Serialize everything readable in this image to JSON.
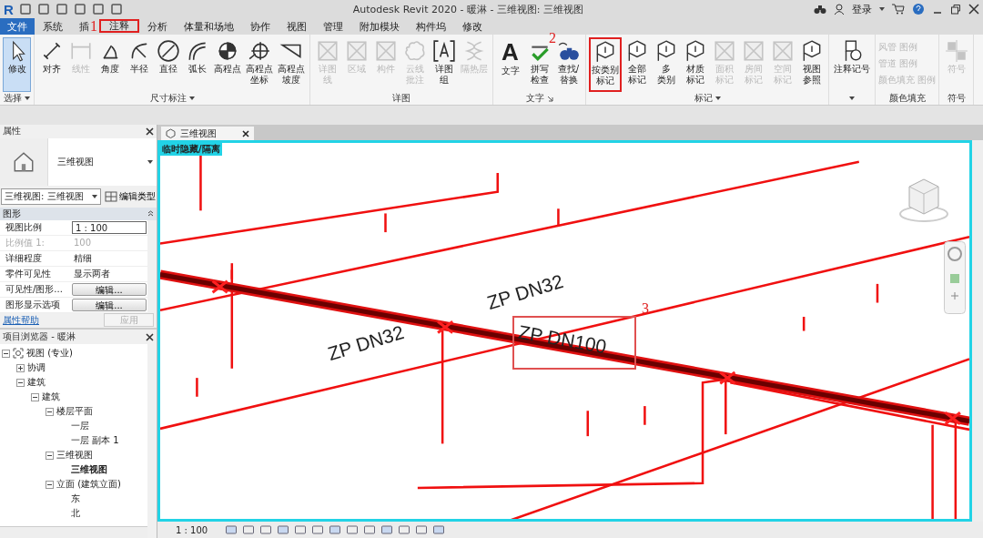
{
  "title_bar": {
    "logo": "R",
    "title": "Autodesk Revit 2020 - 暖淋 - 三维视图: 三维视图",
    "sign_in": "登录"
  },
  "tabs": [
    {
      "label": "文件",
      "kind": "file",
      "selected": false
    },
    {
      "label": "系统",
      "kind": "tab",
      "selected": false
    },
    {
      "label": "插",
      "kind": "tab",
      "selected": false
    },
    {
      "label": "注释",
      "kind": "tab",
      "selected": true
    },
    {
      "label": "分析",
      "kind": "tab",
      "selected": false
    },
    {
      "label": "体量和场地",
      "kind": "tab",
      "selected": false
    },
    {
      "label": "协作",
      "kind": "tab",
      "selected": false
    },
    {
      "label": "视图",
      "kind": "tab",
      "selected": false
    },
    {
      "label": "管理",
      "kind": "tab",
      "selected": false
    },
    {
      "label": "附加模块",
      "kind": "tab",
      "selected": false
    },
    {
      "label": "构件坞",
      "kind": "tab",
      "selected": false
    },
    {
      "label": "修改",
      "kind": "tab",
      "selected": false
    }
  ],
  "ribbon": [
    {
      "title": "选择",
      "menu": true,
      "launcher": false,
      "buttons": [
        {
          "lines": [
            "修改"
          ],
          "kind": "cursor",
          "disabled": false,
          "selected": true,
          "highlighted": false
        }
      ]
    },
    {
      "title": "尺寸标注",
      "menu": true,
      "launcher": false,
      "buttons": [
        {
          "lines": [
            "对齐"
          ],
          "kind": "dimension",
          "disabled": false,
          "selected": false,
          "highlighted": false
        },
        {
          "lines": [
            "线性"
          ],
          "kind": "linear",
          "disabled": true,
          "selected": false,
          "highlighted": false
        },
        {
          "lines": [
            "角度"
          ],
          "kind": "angle",
          "disabled": false,
          "selected": false,
          "highlighted": false
        },
        {
          "lines": [
            "半径"
          ],
          "kind": "radius",
          "disabled": false,
          "selected": false,
          "highlighted": false
        },
        {
          "lines": [
            "直径"
          ],
          "kind": "diameter",
          "disabled": false,
          "selected": false,
          "highlighted": false
        },
        {
          "lines": [
            "弧长"
          ],
          "kind": "arc",
          "disabled": false,
          "selected": false,
          "highlighted": false
        },
        {
          "lines": [
            "高程点"
          ],
          "kind": "spot",
          "disabled": false,
          "selected": false,
          "highlighted": false
        },
        {
          "lines": [
            "高程点",
            "坐标"
          ],
          "kind": "target",
          "disabled": false,
          "selected": false,
          "highlighted": false
        },
        {
          "lines": [
            "高程点",
            "坡度"
          ],
          "kind": "slope",
          "disabled": false,
          "selected": false,
          "highlighted": false
        }
      ]
    },
    {
      "title": "详图",
      "menu": false,
      "launcher": false,
      "buttons": [
        {
          "lines": [
            "详图",
            "线"
          ],
          "kind": "frame",
          "disabled": true,
          "selected": false,
          "highlighted": false
        },
        {
          "lines": [
            "区域"
          ],
          "kind": "frame",
          "disabled": true,
          "selected": false,
          "highlighted": false
        },
        {
          "lines": [
            "构件"
          ],
          "kind": "frame",
          "disabled": true,
          "selected": false,
          "highlighted": false
        },
        {
          "lines": [
            "云线",
            "批注"
          ],
          "kind": "cloud",
          "disabled": true,
          "selected": false,
          "highlighted": false
        },
        {
          "lines": [
            "详图",
            "组"
          ],
          "kind": "group",
          "disabled": false,
          "selected": false,
          "highlighted": false
        },
        {
          "lines": [
            "隔热层"
          ],
          "kind": "coil",
          "disabled": true,
          "selected": false,
          "highlighted": false
        }
      ]
    },
    {
      "title": "文字",
      "menu": false,
      "launcher": true,
      "buttons": [
        {
          "lines": [
            "文字"
          ],
          "kind": "letter",
          "glyph": "A",
          "disabled": false,
          "selected": false,
          "highlighted": false
        },
        {
          "lines": [
            "拼写",
            "检查"
          ],
          "kind": "spell",
          "disabled": false,
          "selected": false,
          "highlighted": false
        },
        {
          "lines": [
            "查找/",
            "替换"
          ],
          "kind": "find",
          "disabled": false,
          "selected": false,
          "highlighted": false
        }
      ]
    },
    {
      "title": "标记",
      "menu": true,
      "launcher": false,
      "buttons": [
        {
          "lines": [
            "按类别",
            "标记"
          ],
          "kind": "tag",
          "disabled": false,
          "selected": false,
          "highlighted": true
        },
        {
          "lines": [
            "全部",
            "标记"
          ],
          "kind": "tag",
          "disabled": false,
          "selected": false,
          "highlighted": false
        },
        {
          "lines": [
            "多",
            "类别"
          ],
          "kind": "tag",
          "disabled": false,
          "selected": false,
          "highlighted": false
        },
        {
          "lines": [
            "材质",
            "标记"
          ],
          "kind": "tag",
          "disabled": false,
          "selected": false,
          "highlighted": false
        },
        {
          "lines": [
            "面积",
            "标记"
          ],
          "kind": "frame",
          "disabled": true,
          "selected": false,
          "highlighted": false
        },
        {
          "lines": [
            "房间",
            "标记"
          ],
          "kind": "frame",
          "disabled": true,
          "selected": false,
          "highlighted": false
        },
        {
          "lines": [
            "空间",
            "标记"
          ],
          "kind": "frame",
          "disabled": true,
          "selected": false,
          "highlighted": false
        },
        {
          "lines": [
            "视图",
            "参照"
          ],
          "kind": "tag",
          "disabled": false,
          "selected": false,
          "highlighted": false
        }
      ]
    },
    {
      "menu": true,
      "launcher": false,
      "buttons": [
        {
          "lines": [
            "注释记号"
          ],
          "kind": "keynote",
          "disabled": false,
          "selected": false,
          "highlighted": false
        }
      ]
    },
    {
      "title": "颜色填充",
      "menu": false,
      "launcher": false,
      "small": [
        {
          "label": "风管 图例",
          "disabled": true
        },
        {
          "label": "管道 图例",
          "disabled": true
        },
        {
          "label": "颜色填充 图例",
          "disabled": true
        }
      ]
    },
    {
      "title": "符号",
      "menu": false,
      "launcher": false,
      "buttons": [
        {
          "lines": [
            "符号"
          ],
          "kind": "symbol",
          "disabled": true,
          "selected": false,
          "highlighted": false
        }
      ]
    }
  ],
  "properties": {
    "title": "属性",
    "type_name": "三维视图",
    "type_selector": "三维视图: 三维视图",
    "edit_type": "编辑类型",
    "group": "图形",
    "rows": [
      {
        "label": "视图比例",
        "value": "1 : 100",
        "kind": "input",
        "disabled": false
      },
      {
        "label": "比例值 1:",
        "value": "100",
        "kind": "text",
        "disabled": true
      },
      {
        "label": "详细程度",
        "value": "精细",
        "kind": "text",
        "disabled": false
      },
      {
        "label": "零件可见性",
        "value": "显示两者",
        "kind": "text",
        "disabled": false
      },
      {
        "label": "可见性/图形...",
        "value": "编辑...",
        "kind": "button",
        "disabled": false
      },
      {
        "label": "图形显示选项",
        "value": "编辑...",
        "kind": "button",
        "disabled": false
      }
    ],
    "help": "属性帮助",
    "apply": "应用"
  },
  "browser": {
    "title": "项目浏览器 - 暖淋",
    "tree": [
      {
        "label": "视图 (专业)",
        "expanded": true,
        "selected": false,
        "children": [
          {
            "label": "协调",
            "expanded": false,
            "selected": false
          },
          {
            "label": "建筑",
            "expanded": true,
            "selected": false,
            "children": [
              {
                "label": "建筑",
                "expanded": true,
                "selected": false,
                "children": [
                  {
                    "label": "楼层平面",
                    "expanded": true,
                    "selected": false,
                    "children": [
                      {
                        "label": "一层",
                        "selected": false
                      },
                      {
                        "label": "一层 副本 1",
                        "selected": false
                      }
                    ]
                  },
                  {
                    "label": "三维视图",
                    "expanded": true,
                    "selected": false,
                    "children": [
                      {
                        "label": "三维视图",
                        "selected": true
                      }
                    ]
                  },
                  {
                    "label": "立面 (建筑立面)",
                    "expanded": true,
                    "selected": false,
                    "children": [
                      {
                        "label": "东",
                        "selected": false
                      },
                      {
                        "label": "北",
                        "selected": false
                      }
                    ]
                  }
                ]
              }
            ]
          }
        ]
      }
    ]
  },
  "view_tab": {
    "label": "三维视图"
  },
  "canvas": {
    "mode_label": "临时隐藏/隔离",
    "tags": [
      {
        "text": "ZP DN32",
        "kind": "left"
      },
      {
        "text": "ZP DN32",
        "kind": "right"
      },
      {
        "text": "ZP DN100",
        "kind": "main"
      }
    ]
  },
  "annotations": [
    {
      "text": "1"
    },
    {
      "text": "2"
    },
    {
      "text": "3"
    }
  ],
  "status_bar": {
    "scale": "1 : 100"
  }
}
